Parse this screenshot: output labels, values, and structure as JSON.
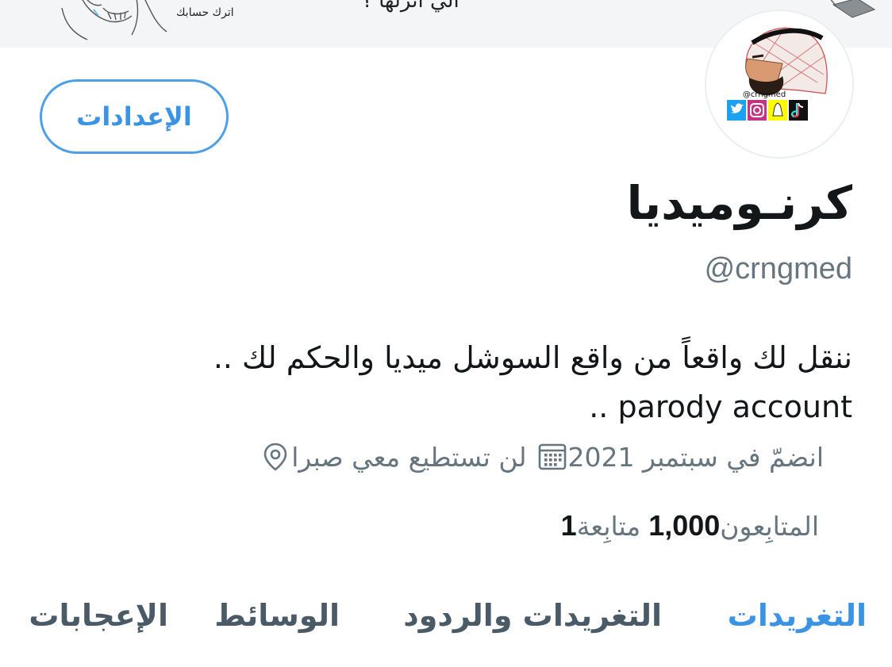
{
  "banner": {
    "caption_small": "اترك حسابك",
    "caption_large": "الي انزلها ؟"
  },
  "avatar": {
    "handle_text": "@crngmed",
    "icons": [
      "twitter-icon",
      "instagram-icon",
      "snapchat-icon",
      "tiktok-icon"
    ]
  },
  "profile": {
    "settings_label": "الإعدادات",
    "display_name": "كرنـوميديا",
    "handle": "@crngmed",
    "bio_line1": "ننقل لك واقعاً من واقع السوشل ميديا والحكم لك ..",
    "bio_line2": "parody account .."
  },
  "meta": {
    "location": "لن تستطيع معي صبرا",
    "joined": "انضمّ في سبتمبر 2021"
  },
  "stats": {
    "following_count": "1",
    "following_label": "متابِعة",
    "followers_count": "1,000",
    "followers_label": "المتابِعون"
  },
  "tabs": [
    {
      "label": "التغريدات",
      "active": true
    },
    {
      "label": "التغريدات والردود",
      "active": false
    },
    {
      "label": "الوسائط",
      "active": false
    },
    {
      "label": "الإعجابات",
      "active": false
    }
  ],
  "colors": {
    "accent": "#3b94e3",
    "text_primary": "#14171a",
    "text_secondary": "#67757f"
  }
}
